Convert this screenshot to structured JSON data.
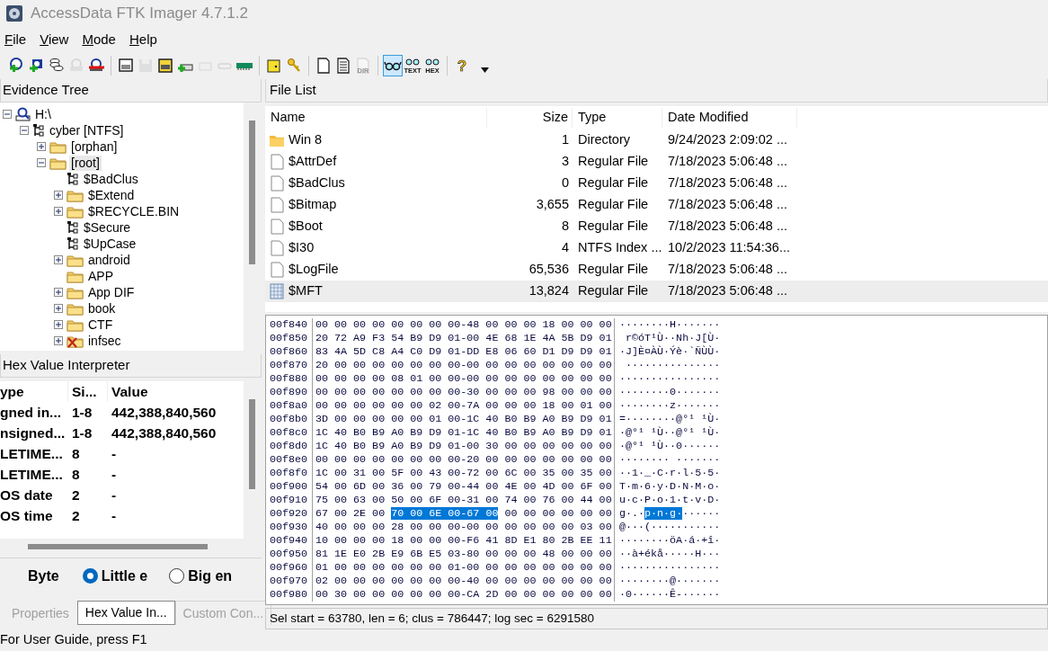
{
  "window": {
    "title": "AccessData FTK Imager 4.7.1.2"
  },
  "menu": [
    "File",
    "View",
    "Mode",
    "Help"
  ],
  "toolbar": {
    "groups": [
      [
        {
          "disabled": false,
          "selected": false
        },
        {
          "disabled": false,
          "selected": false
        },
        {
          "disabled": false,
          "selected": false
        },
        {
          "disabled": true,
          "selected": false
        },
        {
          "disabled": false,
          "selected": false
        }
      ],
      [
        {
          "disabled": false,
          "selected": false
        },
        {
          "disabled": true,
          "selected": false
        },
        {
          "disabled": false,
          "selected": false
        },
        {
          "disabled": false,
          "selected": false
        },
        {
          "disabled": true,
          "selected": false
        },
        {
          "disabled": true,
          "selected": false
        },
        {
          "disabled": false,
          "selected": false
        }
      ],
      [
        {
          "disabled": false,
          "selected": false
        },
        {
          "disabled": false,
          "selected": false
        }
      ],
      [
        {
          "disabled": false,
          "selected": false
        },
        {
          "disabled": false,
          "selected": false
        },
        {
          "disabled": true,
          "selected": false,
          "caption": "DIR"
        }
      ],
      [
        {
          "disabled": false,
          "selected": true
        },
        {
          "disabled": false,
          "selected": false,
          "caption": "TEXT"
        },
        {
          "disabled": false,
          "selected": false,
          "caption": "HEX"
        }
      ],
      [
        {
          "disabled": false,
          "selected": false,
          "caption": "?"
        }
      ]
    ]
  },
  "evidence_tree": {
    "title": "Evidence Tree",
    "items": [
      {
        "label": "H:\\",
        "kind": "drive",
        "expanded": true,
        "selected": false,
        "children": [
          {
            "label": "cyber  [NTFS]",
            "kind": "partition",
            "expanded": true,
            "selected": false,
            "children": [
              {
                "label": "[orphan]",
                "kind": "folder",
                "expanded": false,
                "selected": false
              },
              {
                "label": "[root]",
                "kind": "folder",
                "expanded": true,
                "selected": true,
                "children": [
                  {
                    "label": "$BadClus",
                    "kind": "system",
                    "selected": false
                  },
                  {
                    "label": "$Extend",
                    "kind": "folder",
                    "expanded": false,
                    "selected": false
                  },
                  {
                    "label": "$RECYCLE.BIN",
                    "kind": "folder",
                    "expanded": false,
                    "selected": false
                  },
                  {
                    "label": "$Secure",
                    "kind": "system",
                    "selected": false
                  },
                  {
                    "label": "$UpCase",
                    "kind": "system",
                    "selected": false
                  },
                  {
                    "label": "android",
                    "kind": "folder",
                    "expanded": false,
                    "selected": false
                  },
                  {
                    "label": "APP",
                    "kind": "folder",
                    "selected": false
                  },
                  {
                    "label": "App DIF",
                    "kind": "folder",
                    "expanded": false,
                    "selected": false
                  },
                  {
                    "label": "book",
                    "kind": "folder",
                    "expanded": false,
                    "selected": false
                  },
                  {
                    "label": "CTF",
                    "kind": "folder",
                    "expanded": false,
                    "selected": false
                  },
                  {
                    "label": "infsec",
                    "kind": "deleted",
                    "expanded": false,
                    "selected": false
                  }
                ]
              }
            ]
          }
        ]
      }
    ]
  },
  "interpreter": {
    "title": "Hex Value Interpreter",
    "columns": [
      "ype",
      "Si...",
      "Value"
    ],
    "rows": [
      [
        "gned in...",
        "1-8",
        "442,388,840,560"
      ],
      [
        "nsigned...",
        "1-8",
        "442,388,840,560"
      ],
      [
        "LETIME...",
        "8",
        "-"
      ],
      [
        "LETIME...",
        "8",
        "-"
      ],
      [
        "OS date",
        "2",
        "-"
      ],
      [
        "OS time",
        "2",
        "-"
      ]
    ],
    "byte_order_label": "Byte",
    "options": [
      {
        "label": "Little e",
        "selected": true
      },
      {
        "label": "Big en",
        "selected": false
      }
    ]
  },
  "left_tabs": [
    {
      "label": "Properties",
      "selected": false
    },
    {
      "label": "Hex Value In...",
      "selected": true
    },
    {
      "label": "Custom Con...",
      "selected": false
    }
  ],
  "file_list": {
    "title": "File List",
    "columns": [
      "Name",
      "Size",
      "Type",
      "Date Modified"
    ],
    "rows": [
      {
        "kind": "folder",
        "name": "Win 8",
        "size": "1",
        "type": "Directory",
        "date": "9/24/2023 2:09:02 ...",
        "selected": false
      },
      {
        "kind": "file",
        "name": "$AttrDef",
        "size": "3",
        "type": "Regular File",
        "date": "7/18/2023 5:06:48 ...",
        "selected": false
      },
      {
        "kind": "file",
        "name": "$BadClus",
        "size": "0",
        "type": "Regular File",
        "date": "7/18/2023 5:06:48 ...",
        "selected": false
      },
      {
        "kind": "file",
        "name": "$Bitmap",
        "size": "3,655",
        "type": "Regular File",
        "date": "7/18/2023 5:06:48 ...",
        "selected": false
      },
      {
        "kind": "file",
        "name": "$Boot",
        "size": "8",
        "type": "Regular File",
        "date": "7/18/2023 5:06:48 ...",
        "selected": false
      },
      {
        "kind": "file",
        "name": "$I30",
        "size": "4",
        "type": "NTFS Index ...",
        "date": "10/2/2023 11:54:36...",
        "selected": false
      },
      {
        "kind": "file",
        "name": "$LogFile",
        "size": "65,536",
        "type": "Regular File",
        "date": "7/18/2023 5:06:48 ...",
        "selected": false
      },
      {
        "kind": "mft",
        "name": "$MFT",
        "size": "13,824",
        "type": "Regular File",
        "date": "7/18/2023 5:06:48 ...",
        "selected": true
      }
    ]
  },
  "hex_view": {
    "rows": [
      {
        "offset": "00f840",
        "hex": [
          {
            "text": "00 00 00 00 00 00 00 00-48 00 00 00 18 00 00 00",
            "selected": false
          }
        ],
        "ascii": [
          {
            "text": "········H·······",
            "selected": false
          }
        ]
      },
      {
        "offset": "00f850",
        "hex": [
          {
            "text": "20 72 A9 F3 54 B9 D9 01-00 4E 68 1E 4A 5B D9 01",
            "selected": false
          }
        ],
        "ascii": [
          {
            "text": " r©óT¹Ù··Nh·J[Ù·",
            "selected": false
          }
        ]
      },
      {
        "offset": "00f860",
        "hex": [
          {
            "text": "83 4A 5D C8 A4 C0 D9 01-DD E8 06 60 D1 D9 D9 01",
            "selected": false
          }
        ],
        "ascii": [
          {
            "text": "·J]È¤ÀÙ·Ýè·`ÑÙÙ·",
            "selected": false
          }
        ]
      },
      {
        "offset": "00f870",
        "hex": [
          {
            "text": "20 00 00 00 00 00 00 00-00 00 00 00 00 00 00 00",
            "selected": false
          }
        ],
        "ascii": [
          {
            "text": " ···············",
            "selected": false
          }
        ]
      },
      {
        "offset": "00f880",
        "hex": [
          {
            "text": "00 00 00 00 08 01 00 00-00 00 00 00 00 00 00 00",
            "selected": false
          }
        ],
        "ascii": [
          {
            "text": "················",
            "selected": false
          }
        ]
      },
      {
        "offset": "00f890",
        "hex": [
          {
            "text": "00 00 00 00 00 00 00 00-30 00 00 00 98 00 00 00",
            "selected": false
          }
        ],
        "ascii": [
          {
            "text": "········0·······",
            "selected": false
          }
        ]
      },
      {
        "offset": "00f8a0",
        "hex": [
          {
            "text": "00 00 00 00 00 00 02 00-7A 00 00 00 18 00 01 00",
            "selected": false
          }
        ],
        "ascii": [
          {
            "text": "········z·······",
            "selected": false
          }
        ]
      },
      {
        "offset": "00f8b0",
        "hex": [
          {
            "text": "3D 00 00 00 00 00 01 00-1C 40 B0 B9 A0 B9 D9 01",
            "selected": false
          }
        ],
        "ascii": [
          {
            "text": "=········@°¹ ¹Ù·",
            "selected": false
          }
        ]
      },
      {
        "offset": "00f8c0",
        "hex": [
          {
            "text": "1C 40 B0 B9 A0 B9 D9 01-1C 40 B0 B9 A0 B9 D9 01",
            "selected": false
          }
        ],
        "ascii": [
          {
            "text": "·@°¹ ¹Ù··@°¹ ¹Ù·",
            "selected": false
          }
        ]
      },
      {
        "offset": "00f8d0",
        "hex": [
          {
            "text": "1C 40 B0 B9 A0 B9 D9 01-00 30 00 00 00 00 00 00",
            "selected": false
          }
        ],
        "ascii": [
          {
            "text": "·@°¹ ¹Ù··0······",
            "selected": false
          }
        ]
      },
      {
        "offset": "00f8e0",
        "hex": [
          {
            "text": "00 00 00 00 00 00 00 00-20 00 00 00 00 00 00 00",
            "selected": false
          }
        ],
        "ascii": [
          {
            "text": "········ ·······",
            "selected": false
          }
        ]
      },
      {
        "offset": "00f8f0",
        "hex": [
          {
            "text": "1C 00 31 00 5F 00 43 00-72 00 6C 00 35 00 35 00",
            "selected": false
          }
        ],
        "ascii": [
          {
            "text": "··1·_·C·r·l·5·5·",
            "selected": false
          }
        ]
      },
      {
        "offset": "00f900",
        "hex": [
          {
            "text": "54 00 6D 00 36 00 79 00-44 00 4E 00 4D 00 6F 00",
            "selected": false
          }
        ],
        "ascii": [
          {
            "text": "T·m·6·y·D·N·M·o·",
            "selected": false
          }
        ]
      },
      {
        "offset": "00f910",
        "hex": [
          {
            "text": "75 00 63 00 50 00 6F 00-31 00 74 00 76 00 44 00",
            "selected": false
          }
        ],
        "ascii": [
          {
            "text": "u·c·P·o·1·t·v·D·",
            "selected": false
          }
        ]
      },
      {
        "offset": "00f920",
        "hex": [
          {
            "text": "67 00 2E 00 ",
            "selected": false
          },
          {
            "text": "70 00 6E 00-67 00",
            "selected": true
          },
          {
            "text": " 00 00 00 00 00 00",
            "selected": false
          }
        ],
        "ascii": [
          {
            "text": "g·.·",
            "selected": false
          },
          {
            "text": "p·n·g·",
            "selected": true
          },
          {
            "text": "······",
            "selected": false
          }
        ]
      },
      {
        "offset": "00f930",
        "hex": [
          {
            "text": "40 00 00 00 28 00 00 00-00 00 00 00 00 00 03 00",
            "selected": false
          }
        ],
        "ascii": [
          {
            "text": "@···(···········",
            "selected": false
          }
        ]
      },
      {
        "offset": "00f940",
        "hex": [
          {
            "text": "10 00 00 00 18 00 00 00-F6 41 8D E1 80 2B EE 11",
            "selected": false
          }
        ],
        "ascii": [
          {
            "text": "········öA·á·+î·",
            "selected": false
          }
        ]
      },
      {
        "offset": "00f950",
        "hex": [
          {
            "text": "81 1E E0 2B E9 6B E5 03-80 00 00 00 48 00 00 00",
            "selected": false
          }
        ],
        "ascii": [
          {
            "text": "··à+ékå·····H···",
            "selected": false
          }
        ]
      },
      {
        "offset": "00f960",
        "hex": [
          {
            "text": "01 00 00 00 00 00 00 01-00 00 00 00 00 00 00 00",
            "selected": false
          }
        ],
        "ascii": [
          {
            "text": "················",
            "selected": false
          }
        ]
      },
      {
        "offset": "00f970",
        "hex": [
          {
            "text": "02 00 00 00 00 00 00 00-40 00 00 00 00 00 00 00",
            "selected": false
          }
        ],
        "ascii": [
          {
            "text": "········@·······",
            "selected": false
          }
        ]
      },
      {
        "offset": "00f980",
        "hex": [
          {
            "text": "00 30 00 00 00 00 00 00-CA 2D 00 00 00 00 00 00",
            "selected": false
          }
        ],
        "ascii": [
          {
            "text": "·0······Ê-······",
            "selected": false
          }
        ]
      }
    ],
    "status": "Sel start = 63780, len = 6; clus = 786447; log sec = 6291580"
  },
  "status_bar": "For User Guide, press F1"
}
